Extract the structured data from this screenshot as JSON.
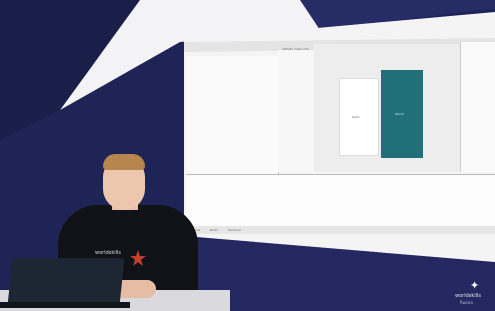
{
  "ide": {
    "tabs": [
      "activity_main.xml",
      "MainActivity.kt"
    ],
    "editor_labels": {
      "left_card": "Hello",
      "right_card": "World"
    },
    "bottom_tabs": [
      "Logcat",
      "Build",
      "Terminal"
    ]
  },
  "branding": {
    "name": "worldskills",
    "sub": "Russia"
  },
  "colors": {
    "accent_teal": "#216f79",
    "background_navy": "#1e2456",
    "shirt_star": "#c8402f"
  }
}
